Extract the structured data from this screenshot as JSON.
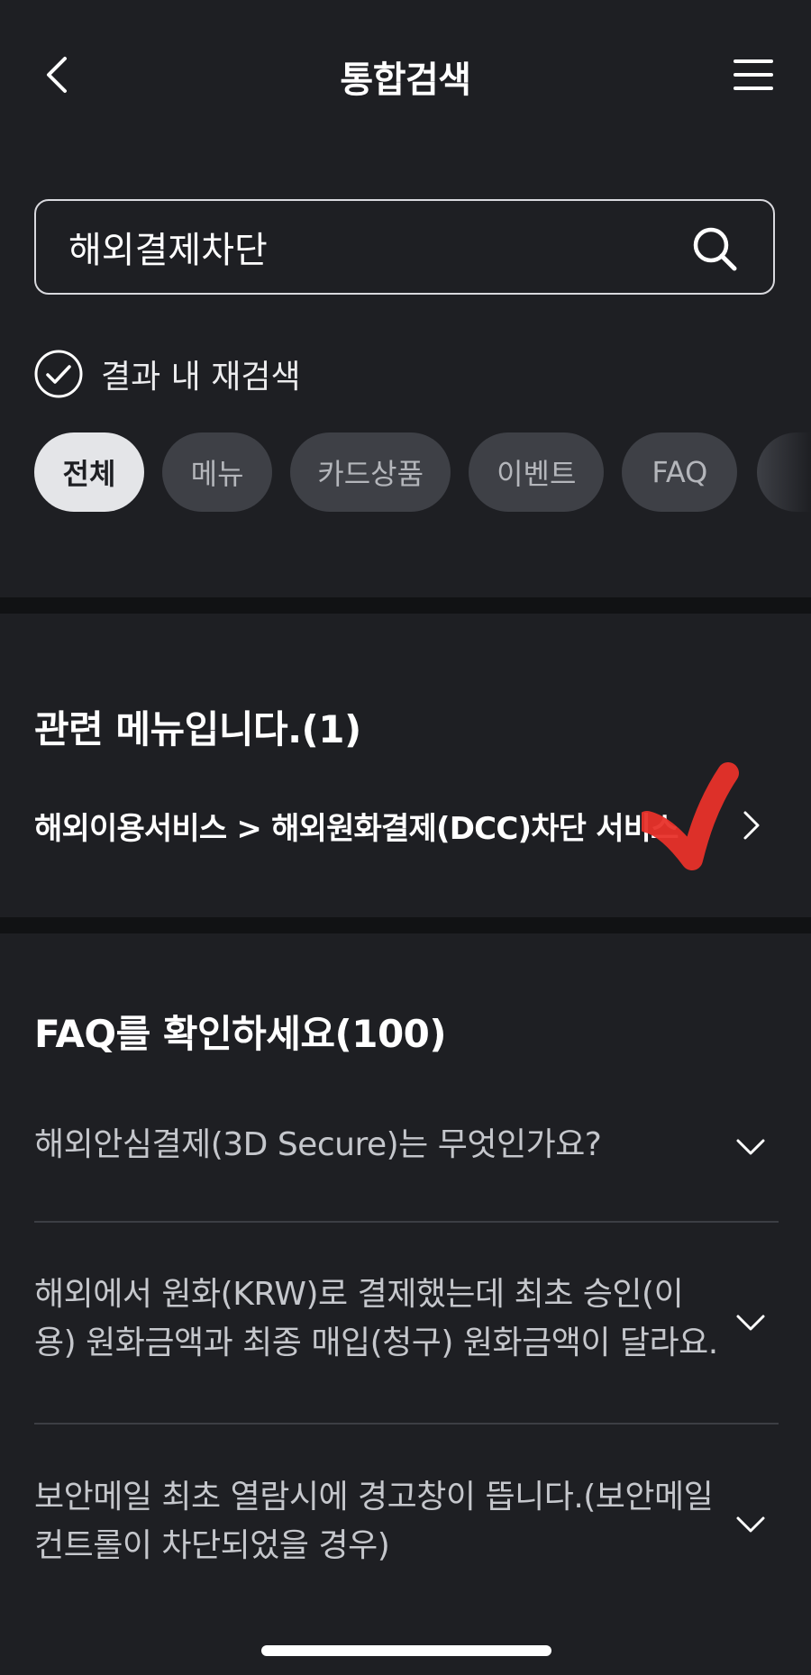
{
  "header": {
    "title": "통합검색",
    "back_icon": "chevron-left-icon",
    "menu_icon": "hamburger-menu-icon"
  },
  "search": {
    "value": "해외결제차단",
    "placeholder": "",
    "search_icon": "search-icon"
  },
  "refine": {
    "label": "결과 내 재검색",
    "checked": true
  },
  "tabs": [
    {
      "label": "전체",
      "active": true
    },
    {
      "label": "메뉴",
      "active": false
    },
    {
      "label": "카드상품",
      "active": false
    },
    {
      "label": "이벤트",
      "active": false
    },
    {
      "label": "FAQ",
      "active": false
    }
  ],
  "menu_section": {
    "title": "관련 메뉴입니다.(1)",
    "items": [
      {
        "label": "해외이용서비스 > 해외원화결제(DCC)차단 서비스"
      }
    ]
  },
  "faq_section": {
    "title": "FAQ를 확인하세요(100)",
    "items": [
      {
        "question": "해외안심결제(3D Secure)는 무엇인가요?"
      },
      {
        "question": "해외에서 원화(KRW)로 결제했는데 최초 승인(이용) 원화금액과 최종 매입(청구) 원화금액이 달라요."
      },
      {
        "question": "보안메일 최초 열람시에 경고창이 뜹니다.(보안메일 컨트롤이 차단되었을 경우)"
      }
    ]
  },
  "colors": {
    "background": "#1e1f23",
    "band": "#111214",
    "chip": "#3e4046",
    "chip_active": "#e4e5e8",
    "annotation": "#e8322a"
  }
}
